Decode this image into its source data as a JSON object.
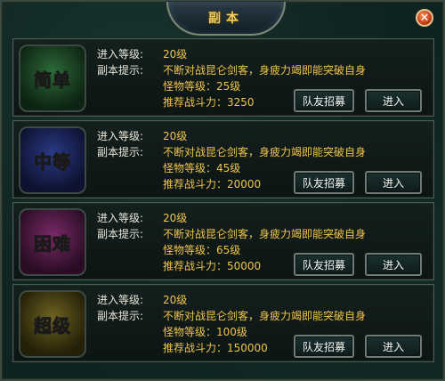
{
  "window": {
    "title": "副本"
  },
  "labels": {
    "level": "进入等级:",
    "hint": "副本提示:"
  },
  "dungeons": [
    {
      "badge_text": "简单",
      "badge_color": "#3fa64a",
      "level": "20级",
      "hint": "不断对战昆仑剑客，身疲力竭即能突破自身",
      "monster_level": "怪物等级：25级",
      "power": "推荐战斗力：3250",
      "recruit_label": "队友招募",
      "enter_label": "进入"
    },
    {
      "badge_text": "中等",
      "badge_color": "#4a62c8",
      "level": "20级",
      "hint": "不断对战昆仑剑客，身疲力竭即能突破自身",
      "monster_level": "怪物等级：45级",
      "power": "推荐战斗力：20000",
      "recruit_label": "队友招募",
      "enter_label": "进入"
    },
    {
      "badge_text": "困难",
      "badge_color": "#c44aa0",
      "level": "20级",
      "hint": "不断对战昆仑剑客，身疲力竭即能突破自身",
      "monster_level": "怪物等级：65级",
      "power": "推荐战斗力：50000",
      "recruit_label": "队友招募",
      "enter_label": "进入"
    },
    {
      "badge_text": "超级",
      "badge_color": "#c9b43a",
      "level": "20级",
      "hint": "不断对战昆仑剑客，身疲力竭即能突破自身",
      "monster_level": "怪物等级：100级",
      "power": "推荐战斗力：150000",
      "recruit_label": "队友招募",
      "enter_label": "进入"
    }
  ]
}
